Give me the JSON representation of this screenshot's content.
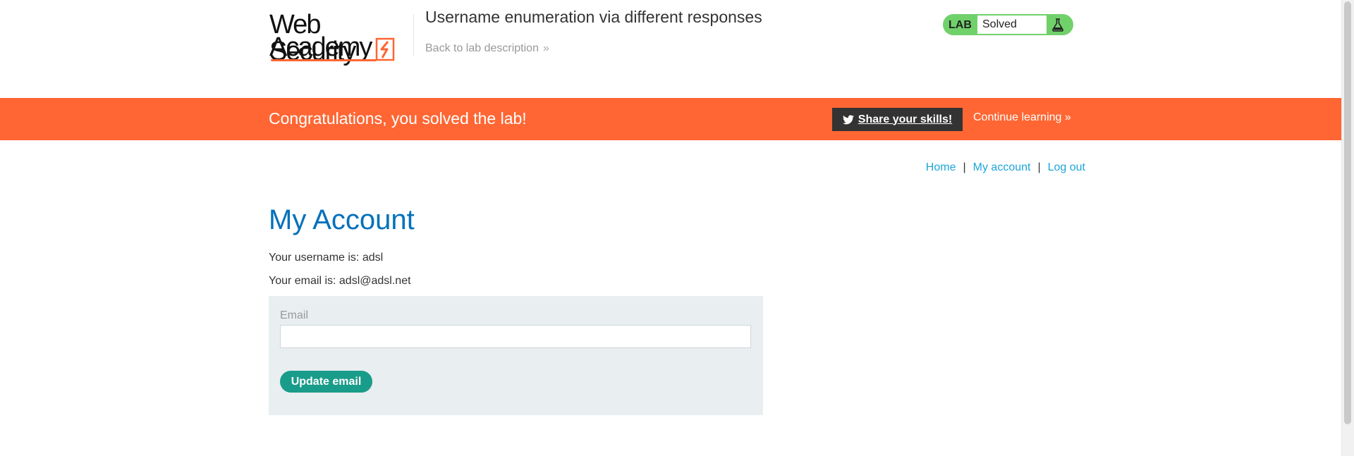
{
  "header": {
    "logo": {
      "line1": "Web Security",
      "line2": "Academy"
    },
    "lab_title": "Username enumeration via different responses",
    "back_link": "Back to lab description",
    "lab_badge": {
      "tag": "LAB",
      "status": "Solved",
      "color": "#70d16b"
    }
  },
  "banner": {
    "message": "Congratulations, you solved the lab!",
    "share_label": "Share your skills!",
    "continue_label": "Continue learning",
    "color": "#ff6633"
  },
  "nav": {
    "home": "Home",
    "separator": "|",
    "my_account": "My account",
    "log_out": "Log out"
  },
  "main": {
    "title": "My Account",
    "username_line": "Your username is: adsl",
    "email_line": "Your email is: adsl@adsl.net",
    "form": {
      "email_label": "Email",
      "email_value": "",
      "submit_label": "Update email"
    }
  },
  "icons": {
    "bolt": "lightning-bolt-icon",
    "flask": "flask-icon",
    "twitter": "twitter-icon",
    "chevron": "double-chevron-right-icon"
  }
}
